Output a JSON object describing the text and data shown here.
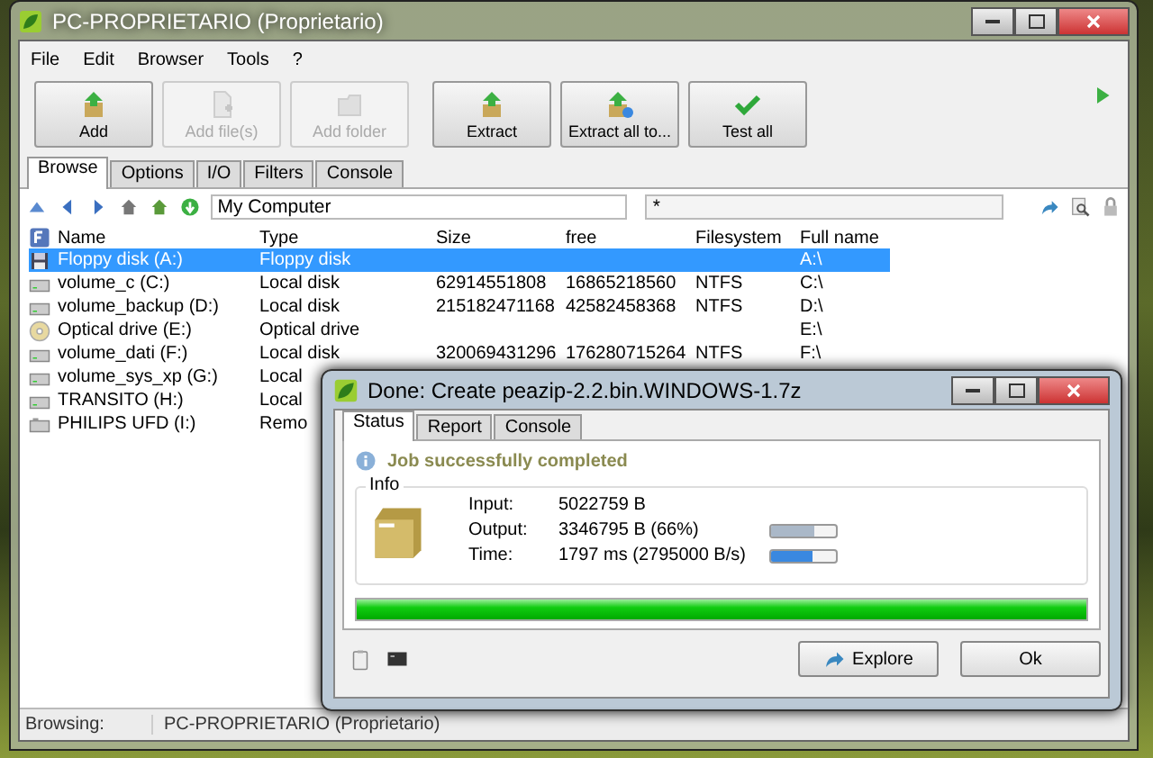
{
  "window": {
    "title": "PC-PROPRIETARIO (Proprietario)"
  },
  "menu": [
    "File",
    "Edit",
    "Browser",
    "Tools",
    "?"
  ],
  "toolbar": [
    {
      "label": "Add",
      "disabled": false
    },
    {
      "label": "Add file(s)",
      "disabled": true
    },
    {
      "label": "Add folder",
      "disabled": true
    },
    {
      "label": "Extract",
      "disabled": false
    },
    {
      "label": "Extract all to...",
      "disabled": false
    },
    {
      "label": "Test all",
      "disabled": false
    }
  ],
  "tabs": [
    {
      "label": "Browse",
      "selected": true
    },
    {
      "label": "Options",
      "selected": false
    },
    {
      "label": "I/O",
      "selected": false
    },
    {
      "label": "Filters",
      "selected": false
    },
    {
      "label": "Console",
      "selected": false
    }
  ],
  "address": {
    "value": "My Computer"
  },
  "filter": {
    "value": "*"
  },
  "table": {
    "columns": [
      "Name",
      "Type",
      "Size",
      "free",
      "Filesystem",
      "Full name"
    ],
    "rows": [
      {
        "kind": "floppy",
        "selected": true,
        "name": "Floppy disk (A:)",
        "type": "Floppy disk",
        "full_name": "A:\\"
      },
      {
        "kind": "disk",
        "selected": false,
        "name": "volume_c (C:)",
        "type": "Local disk",
        "size": "62914551808",
        "free": "16865218560",
        "filesystem": "NTFS",
        "full_name": "C:\\"
      },
      {
        "kind": "disk",
        "selected": false,
        "name": "volume_backup (D:)",
        "type": "Local disk",
        "size": "215182471168",
        "free": "42582458368",
        "filesystem": "NTFS",
        "full_name": "D:\\"
      },
      {
        "kind": "optical",
        "selected": false,
        "name": "Optical drive (E:)",
        "type": "Optical drive",
        "full_name": "E:\\"
      },
      {
        "kind": "disk",
        "selected": false,
        "name": "volume_dati (F:)",
        "type": "Local disk",
        "size": "320069431296",
        "free": "176280715264",
        "filesystem": "NTFS",
        "full_name": "F:\\"
      },
      {
        "kind": "disk",
        "selected": false,
        "name": "volume_sys_xp (G:)",
        "type": "Local"
      },
      {
        "kind": "disk",
        "selected": false,
        "name": "TRANSITO (H:)",
        "type": "Local"
      },
      {
        "kind": "removable",
        "selected": false,
        "name": "PHILIPS UFD (I:)",
        "type": "Remo"
      }
    ]
  },
  "status_bar": {
    "label": "Browsing:",
    "value": "PC-PROPRIETARIO (Proprietario)"
  },
  "dialog": {
    "title": "Done: Create peazip-2.2.bin.WINDOWS-1.7z",
    "tabs": [
      {
        "label": "Status",
        "selected": true
      },
      {
        "label": "Report",
        "selected": false
      },
      {
        "label": "Console",
        "selected": false
      }
    ],
    "message": "Job successfully completed",
    "group_title": "Info",
    "fields": [
      {
        "label": "Input:",
        "value": "5022759 B"
      },
      {
        "kind": "ratio",
        "label": "Output:",
        "value": "3346795 B (66%)",
        "level": 0.66
      },
      {
        "kind": "speed",
        "label": "Time:",
        "value": "1797 ms (2795000 B/s)",
        "level": 0.65
      }
    ],
    "progress": {
      "level": 1
    },
    "buttons": [
      "Explore",
      "Ok"
    ]
  }
}
